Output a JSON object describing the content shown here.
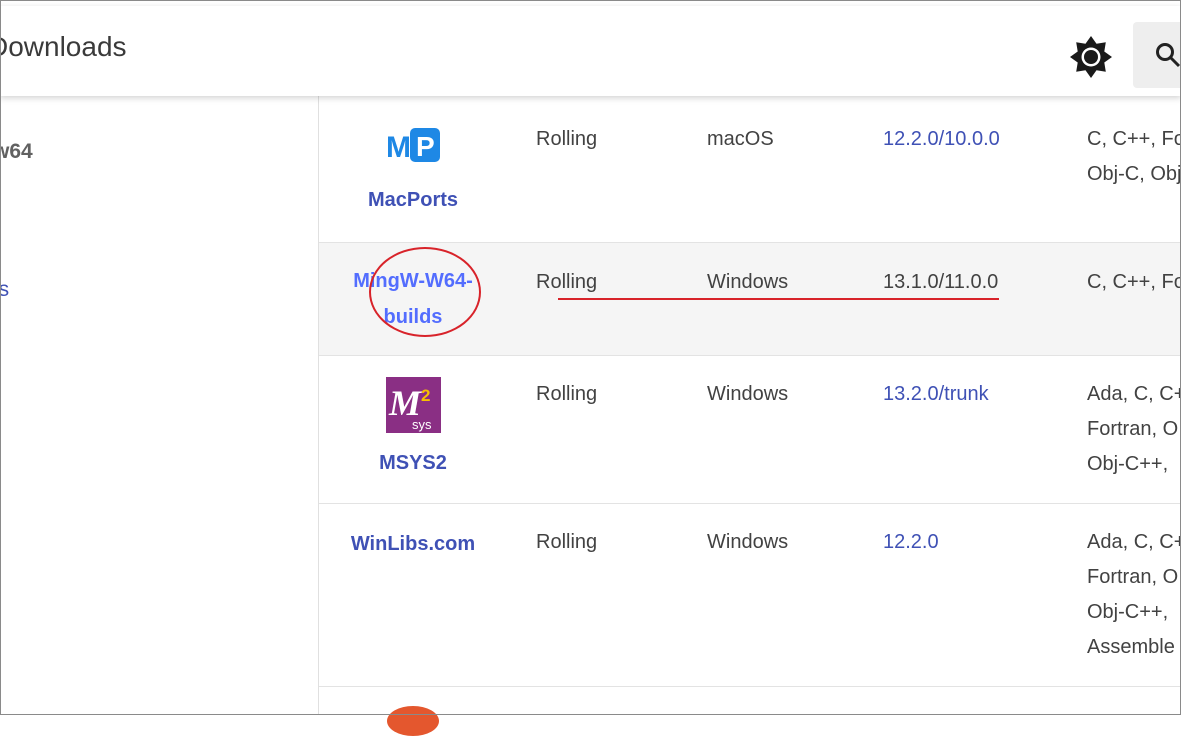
{
  "header": {
    "site_title": "Downloads",
    "theme_icon": "brightness-icon",
    "search_icon": "search-icon"
  },
  "sidebar": {
    "fragment_1": "w64",
    "fragment_2": "ls"
  },
  "rows": [
    {
      "name": "MacPorts",
      "logo": "macports-logo",
      "logo_text": "MP",
      "release": "Rolling",
      "os": "macOS",
      "version": "12.2.0/10.0.0",
      "languages": [
        "C, C++, Fo",
        "Obj-C, Obj"
      ],
      "highlighted": false
    },
    {
      "name_line1": "MingW-W64-",
      "name_line2": "builds",
      "release": "Rolling",
      "os": "Windows",
      "version": "13.1.0/11.0.0",
      "languages": [
        "C, C++, Fo"
      ],
      "highlighted": true
    },
    {
      "name": "MSYS2",
      "logo": "msys2-logo",
      "logo_text": "M",
      "logo_sup": "2",
      "logo_sub": "sys",
      "release": "Rolling",
      "os": "Windows",
      "version": "13.2.0/trunk",
      "languages": [
        "Ada, C, C+",
        "Fortran, O",
        "Obj-C++,"
      ],
      "highlighted": false
    },
    {
      "name": "WinLibs.com",
      "release": "Rolling",
      "os": "Windows",
      "version": "12.2.0",
      "languages": [
        "Ada, C, C+",
        "Fortran, O",
        "Obj-C++,",
        "Assemble"
      ],
      "highlighted": false
    }
  ],
  "colors": {
    "link": "#3f51b5",
    "link_highlight": "#536dfe",
    "annotation": "#d8232a",
    "row_highlight": "#f5f5f5"
  }
}
